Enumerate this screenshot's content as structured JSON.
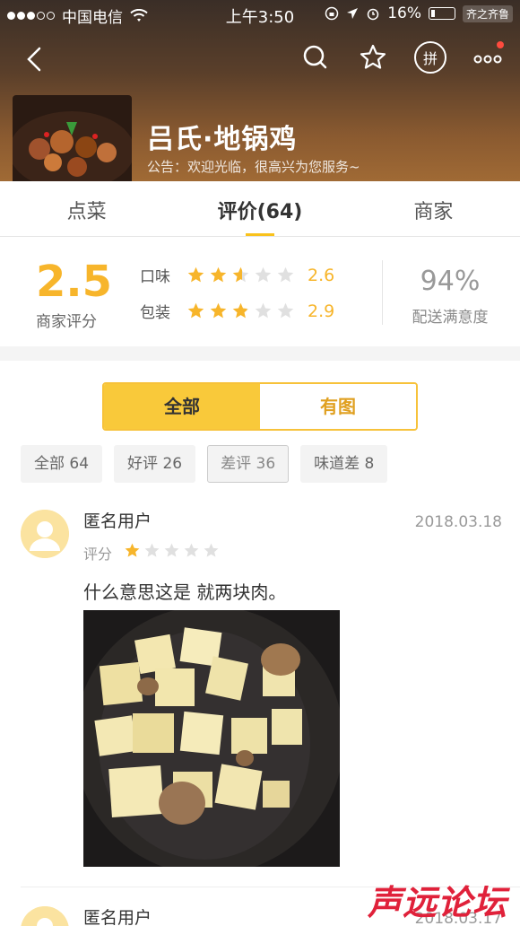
{
  "status_bar": {
    "carrier": "中国电信",
    "time": "上午3:50",
    "battery_text": "16%",
    "tag": "齐之齐鲁"
  },
  "shop": {
    "name": "吕氏·地锅鸡",
    "notice": "公告：欢迎光临，很高兴为您服务~"
  },
  "nav": {
    "pin_label": "拼"
  },
  "tabs": [
    {
      "label": "点菜"
    },
    {
      "label": "评价(64)"
    },
    {
      "label": "商家"
    }
  ],
  "rating": {
    "score": "2.5",
    "score_label": "商家评分",
    "taste": {
      "label": "口味",
      "value": "2.6",
      "stars": 2.6
    },
    "package": {
      "label": "包装",
      "value": "2.9",
      "stars": 2.9
    },
    "delivery_pct": "94%",
    "delivery_label": "配送满意度"
  },
  "colors": {
    "accent": "#f7b52b",
    "star_off": "#e0e0e0",
    "header_brown": "#6a4a2e"
  },
  "filter": {
    "all": "全部",
    "with_pic": "有图",
    "chips": [
      "全部 64",
      "好评 26",
      "差评 36",
      "味道差 8"
    ]
  },
  "reviews": [
    {
      "user": "匿名用户",
      "date": "2018.03.18",
      "rate_label": "评分",
      "stars": 1,
      "text": "什么意思这是 就两块肉。"
    },
    {
      "user": "匿名用户",
      "date": "2018.03.17"
    }
  ],
  "watermark": "声远论坛"
}
